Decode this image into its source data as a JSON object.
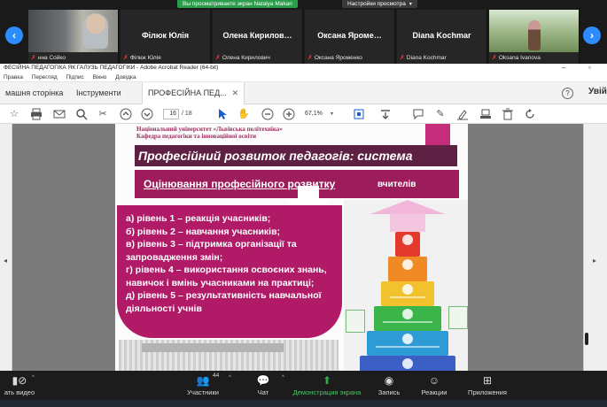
{
  "zoom": {
    "share_banner": "Вы просматриваете экран Natalya Makan",
    "view_options": "Настройки просмотра",
    "tiles": [
      {
        "name": "",
        "footer": "нна Сойко",
        "has_video": true
      },
      {
        "name": "Філюк Юлія",
        "footer": "Філюк Юлія",
        "has_video": false
      },
      {
        "name": "Олена Кирилов…",
        "footer": "Олена Кирилович",
        "has_video": false
      },
      {
        "name": "Оксана Яроме…",
        "footer": "Оксана Яроменко",
        "has_video": false
      },
      {
        "name": "Diana Kochmar",
        "footer": "Diana Kochmar",
        "has_video": false
      },
      {
        "name": "",
        "footer": "Oksana Ivanova",
        "has_video": true
      }
    ],
    "bottom": {
      "video_label": "ать видео",
      "participants_label": "Участники",
      "participants_count": "44",
      "chat_label": "Чат",
      "share_label": "Демонстрация экрана",
      "record_label": "Запись",
      "reactions_label": "Реакции",
      "apps_label": "Приложения"
    }
  },
  "acrobat": {
    "title": "ФЕСІЙНА ПЕДАГОГІКА  ЯК ГАЛУЗЬ ПЕДАГОГІКИ - Adobe Acrobat Reader (64-bit)",
    "menu": [
      "Правка",
      "Перегляд",
      "Підпис",
      "Вікно",
      "Довідка"
    ],
    "tabs": [
      "машня сторінка",
      "Інструменти",
      "ПРОФЕСІЙНА ПЕД..."
    ],
    "user_label": "Увій",
    "page_current": "16",
    "page_total": "/ 18",
    "zoom": "67,1%"
  },
  "slide": {
    "university_line1": "Національний університет «Львівська політехніка»",
    "university_line2": "Кафедра педагогіки та інноваційної освіти",
    "title": "Професійний розвиток педагогів: система",
    "subtitle_link": "Оцінювання професійного розвитку",
    "subtitle_rest": "вчителів",
    "levels": [
      "а) рівень 1 – реакція учасників;",
      "б) рівень 2 – навчання учасників;",
      "в) рівень 3 – підтримка організації та запровадження змін;",
      "г) рівень 4 – використання освоєних знань, навичок і вмінь учасниками на практиці;",
      "д) рівень 5 – результативність навчальної діяльності учнів"
    ]
  },
  "colors": {
    "zoom_green": "#2b9d4a",
    "zoom_blue": "#2d8cff",
    "slide_title_bg": "#5e2143",
    "slide_sub_bg": "#9d1c5c",
    "slide_list_bg": "#b01a67",
    "steps": [
      "#6b3fa0",
      "#3b5fc4",
      "#2e9ad6",
      "#3bb54a",
      "#f2c12e",
      "#f08a24",
      "#e23b2e"
    ]
  }
}
